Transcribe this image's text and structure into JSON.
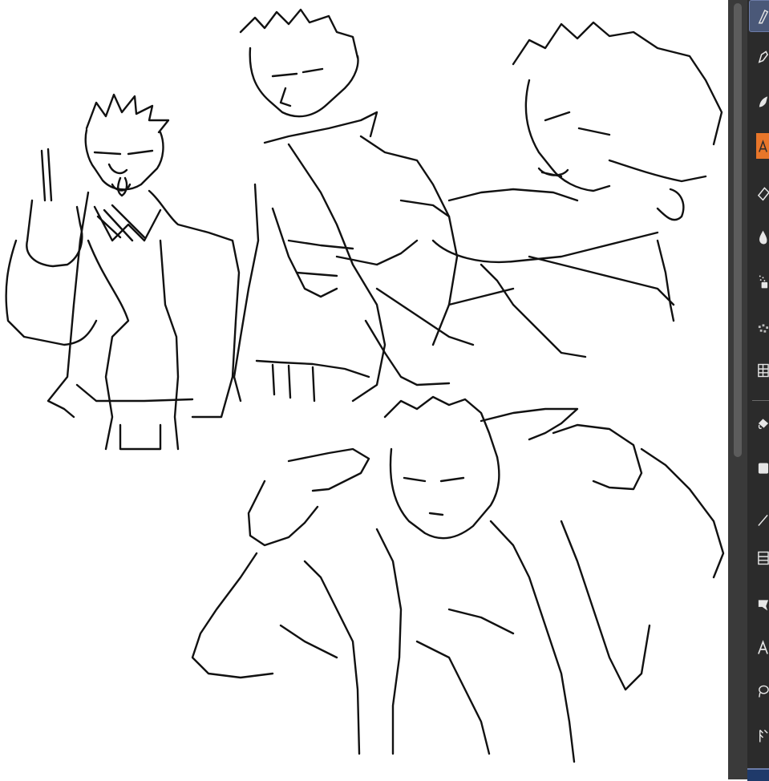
{
  "canvas": {
    "background": "#ffffff",
    "content": "ink line sketch"
  },
  "toolbar": {
    "background": "#2b2b2b",
    "accent": "#e8762a",
    "active_bg": "#4a5878",
    "tools": [
      {
        "name": "pen-tool",
        "icon": "pen-icon",
        "state": "active"
      },
      {
        "name": "pencil-tool",
        "icon": "pencil-icon",
        "state": "normal"
      },
      {
        "name": "brush-tool",
        "icon": "brush-icon",
        "state": "normal"
      },
      {
        "name": "airbrush-tool",
        "icon": "marker-icon",
        "state": "highlighted"
      },
      {
        "name": "eraser-tool",
        "icon": "eraser-icon",
        "state": "normal"
      },
      {
        "name": "blend-tool",
        "icon": "droplet-icon",
        "state": "normal"
      },
      {
        "name": "spray-tool",
        "icon": "spray-icon",
        "state": "normal"
      },
      {
        "name": "texture-tool",
        "icon": "texture-icon",
        "state": "normal"
      },
      {
        "name": "grid-tool",
        "icon": "grid-icon",
        "state": "normal"
      },
      {
        "name": "fill-tool",
        "icon": "bucket-icon",
        "state": "normal"
      },
      {
        "name": "gradient-tool",
        "icon": "gradient-icon",
        "state": "normal"
      },
      {
        "name": "line-tool",
        "icon": "line-icon",
        "state": "normal"
      },
      {
        "name": "frame-tool",
        "icon": "frame-icon",
        "state": "normal"
      },
      {
        "name": "balloon-tool",
        "icon": "balloon-icon",
        "state": "normal"
      },
      {
        "name": "text-tool",
        "icon": "text-icon",
        "state": "normal"
      },
      {
        "name": "lasso-tool",
        "icon": "lasso-icon",
        "state": "normal"
      },
      {
        "name": "ruler-tool",
        "icon": "ruler-icon",
        "state": "normal"
      }
    ]
  }
}
